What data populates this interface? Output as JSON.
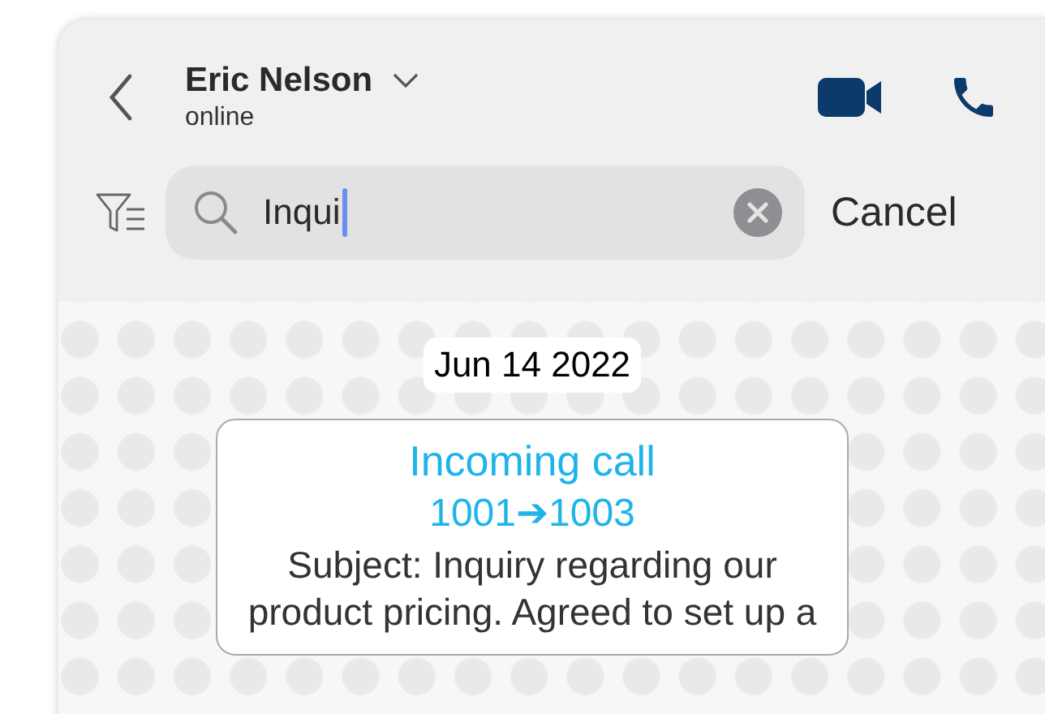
{
  "header": {
    "contact_name": "Eric Nelson",
    "status": "online"
  },
  "search": {
    "value": "Inqui",
    "cancel": "Cancel"
  },
  "messages": [
    {
      "kind": "date",
      "text": "Jun 14 2022"
    },
    {
      "kind": "call",
      "title": "Incoming call",
      "route": "1001➔1003",
      "body": "Subject: Inquiry regarding our product pricing. Agreed to set up a"
    }
  ]
}
